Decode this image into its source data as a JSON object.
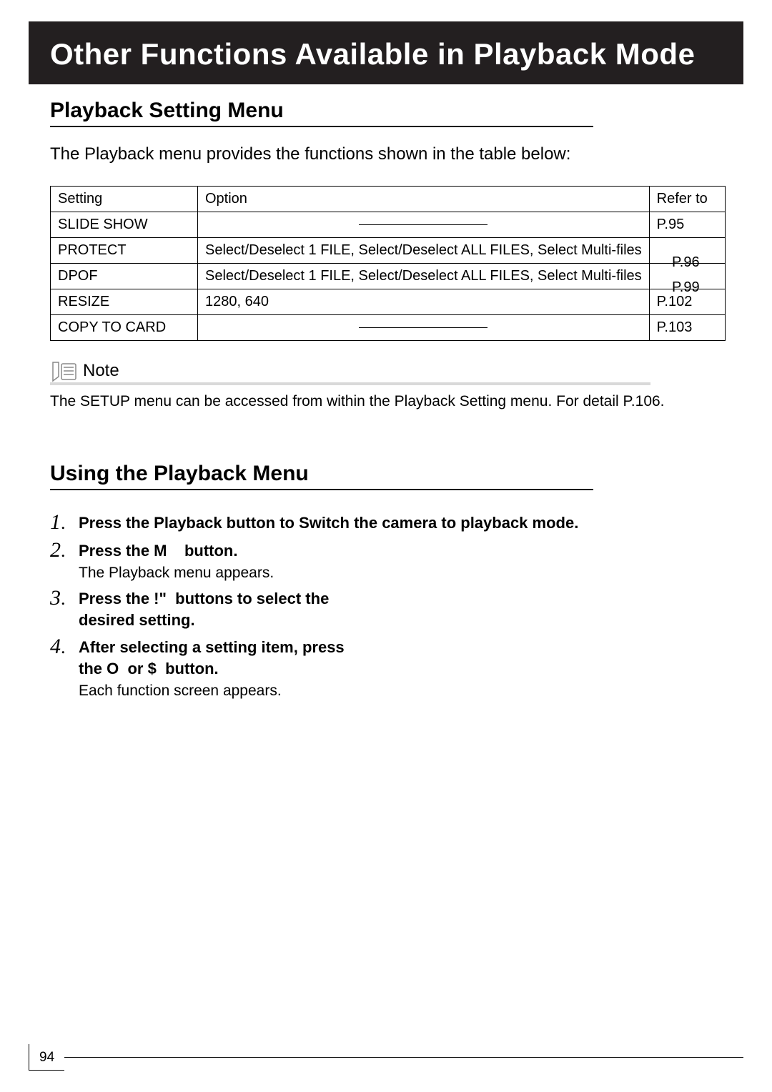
{
  "header": {
    "title": "Other Functions Available in Playback Mode"
  },
  "section1": {
    "title": "Playback Setting Menu",
    "intro": "The Playback menu provides the functions shown in the table below:"
  },
  "table": {
    "h_setting": "Setting",
    "h_option": "Option",
    "h_refer": "Refer to",
    "rows": [
      {
        "setting": "SLIDE SHOW",
        "option": "",
        "refer": "P.95"
      },
      {
        "setting": "PROTECT",
        "option": "Select/Deselect 1 FILE, Select/Deselect ALL FILES, Select Multi-files",
        "refer": "P.96"
      },
      {
        "setting": "DPOF",
        "option": "Select/Deselect 1 FILE, Select/Deselect ALL FILES, Select Multi-files",
        "refer": "P.99"
      },
      {
        "setting": "RESIZE",
        "option": "1280, 640",
        "refer": "P.102"
      },
      {
        "setting": "COPY TO CARD",
        "option": "",
        "refer": "P.103"
      }
    ]
  },
  "note": {
    "label": "Note",
    "body": "The SETUP menu can be accessed from within the Playback Setting menu. For detail P.106."
  },
  "section2": {
    "title": "Using the Playback Menu"
  },
  "steps": {
    "s1": {
      "num": "1",
      "title": "Press the Playback button to Switch the camera to playback mode."
    },
    "s2": {
      "num": "2",
      "title_pre": "Press the ",
      "glyph": "M",
      "title_post": " button.",
      "sub": "The Playback menu appears."
    },
    "s3": {
      "num": "3",
      "title_pre": "Press the ",
      "glyph": "!\"",
      "title_post": " buttons to select the desired setting."
    },
    "s4": {
      "num": "4",
      "title_pre": "After selecting a setting item, press the ",
      "glyph1": "O",
      "mid": " or ",
      "glyph2": "$",
      "title_post": " button.",
      "sub": "Each function screen appears."
    }
  },
  "page_number": "94"
}
